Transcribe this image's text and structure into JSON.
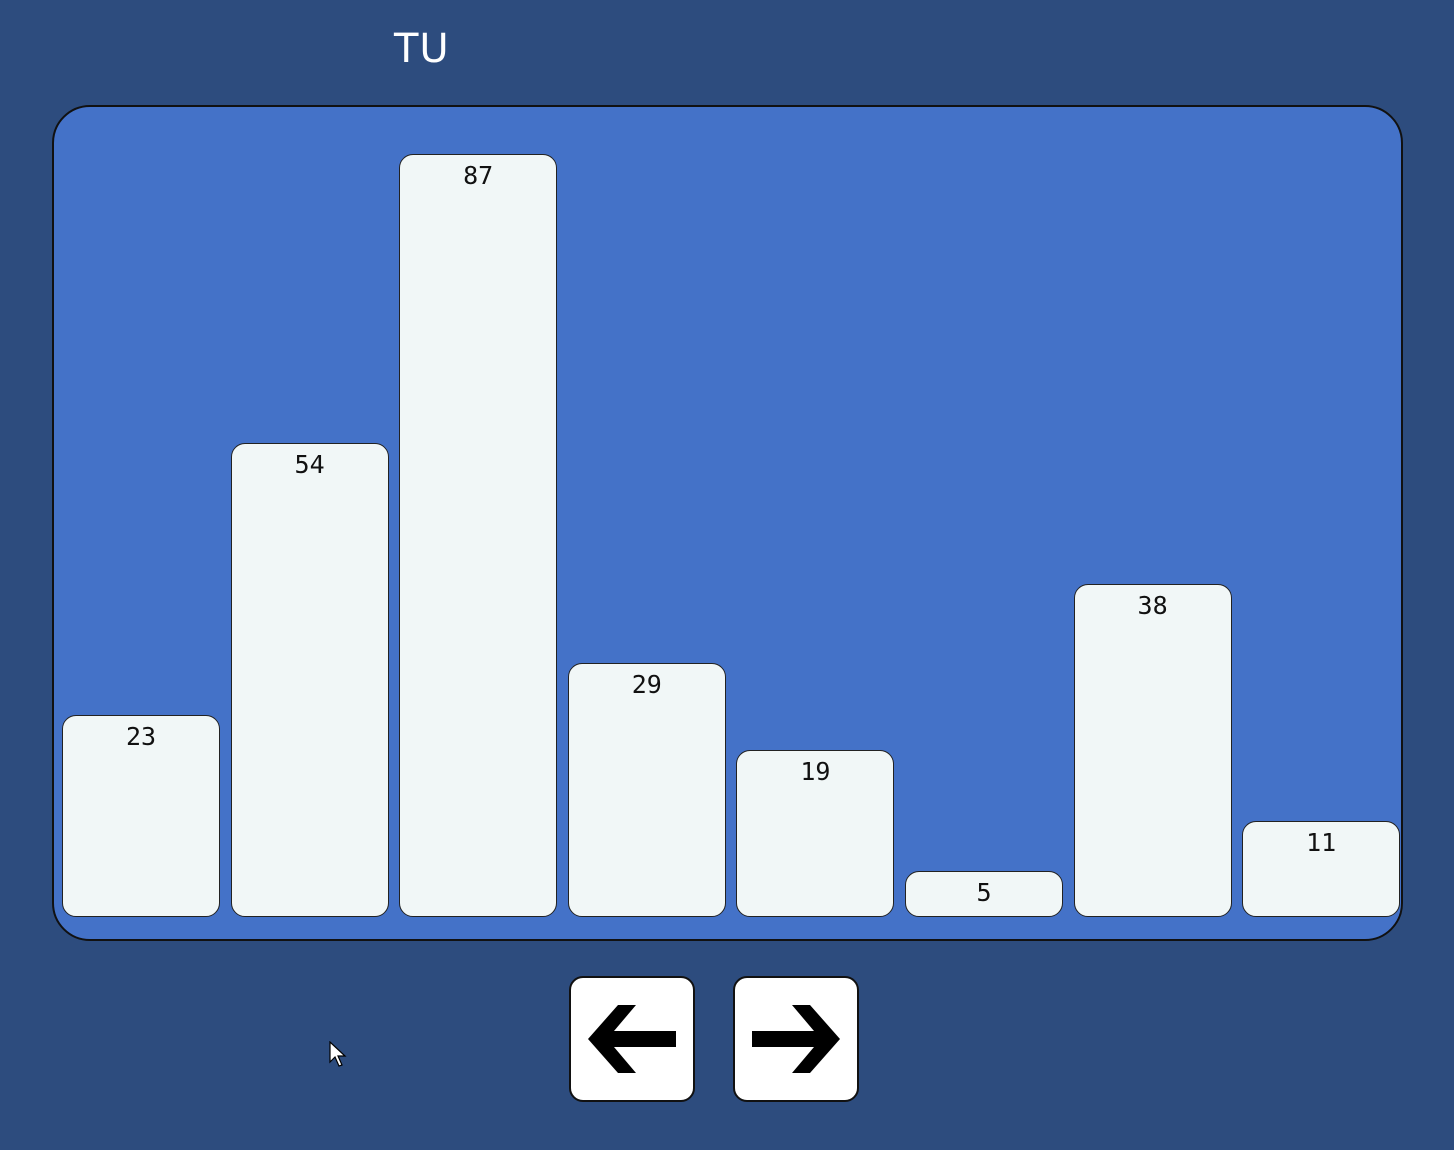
{
  "chart_data": {
    "type": "bar",
    "title": "TU",
    "categories": [
      "",
      "",
      "",
      "",
      "",
      "",
      "",
      ""
    ],
    "values": [
      23,
      54,
      87,
      29,
      19,
      5,
      38,
      11
    ],
    "ylim": [
      0,
      87
    ],
    "grid": false,
    "colors": {
      "background": "#2d4c7e",
      "panel": "#4472c8",
      "bar": "#f1f7f7"
    }
  },
  "controls": {
    "prev_icon": "arrow-left-icon",
    "next_icon": "arrow-right-icon"
  }
}
